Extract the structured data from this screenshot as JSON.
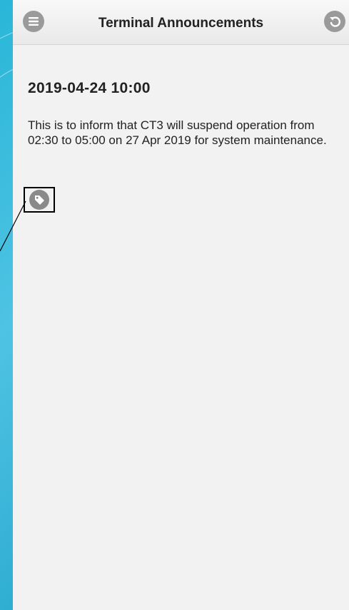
{
  "header": {
    "title": "Terminal Announcements",
    "menu_icon": "menu-icon",
    "back_icon": "back-icon"
  },
  "announcement": {
    "datetime": "2019-04-24 10:00",
    "message": "This is to inform that CT3 will suspend operation from 02:30 to 05:00 on 27 Apr 2019 for system maintenance.",
    "tag_icon": "tag-icon"
  },
  "colors": {
    "background": "#29b6d8",
    "panel": "#f2f2f2",
    "header_button": "#9a9a9a",
    "text": "#222222"
  }
}
